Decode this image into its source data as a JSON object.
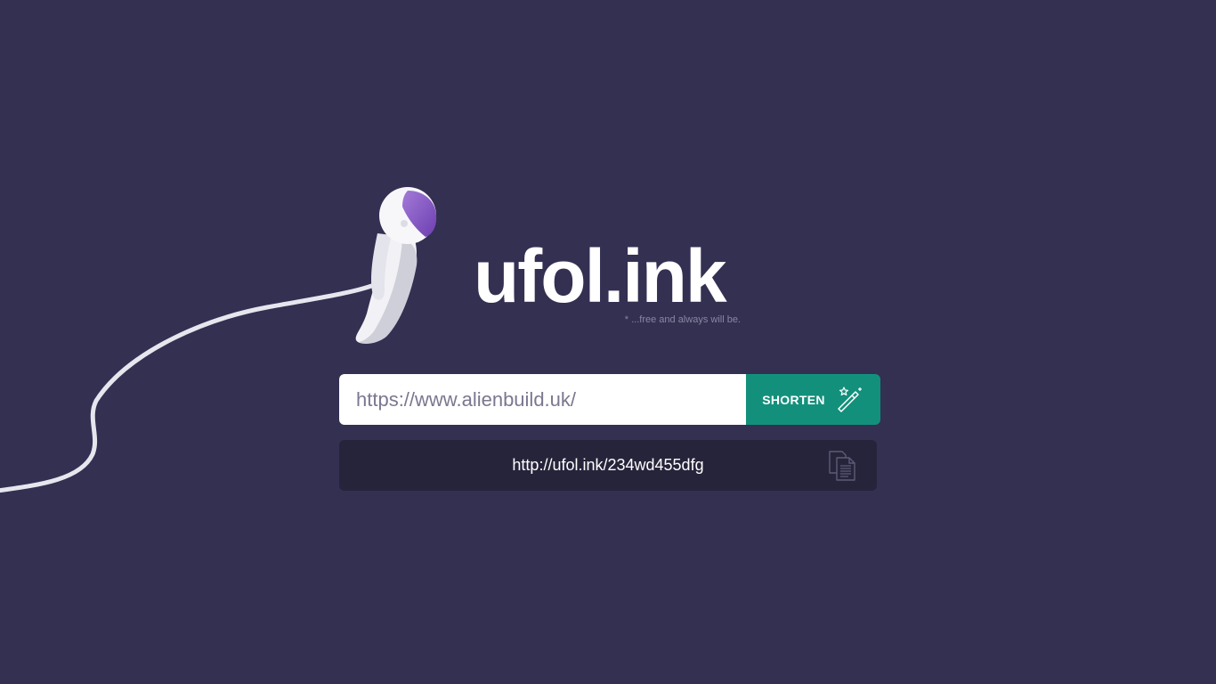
{
  "brand": {
    "logo_text": "ufol.ink",
    "tagline": "* ...free and always will be."
  },
  "form": {
    "url_placeholder": "https://www.alienbuild.uk/",
    "url_value": "",
    "shorten_label": "SHORTEN"
  },
  "result": {
    "short_url": "http://ufol.ink/234wd455dfg"
  },
  "icons": {
    "shorten": "magic-wand-icon",
    "copy": "copy-icon",
    "mascot": "astronaut-illustration"
  },
  "colors": {
    "background": "#333052",
    "accent": "#13907b",
    "result_background": "#26243a",
    "helmet_visor": "#8b5cc4"
  }
}
